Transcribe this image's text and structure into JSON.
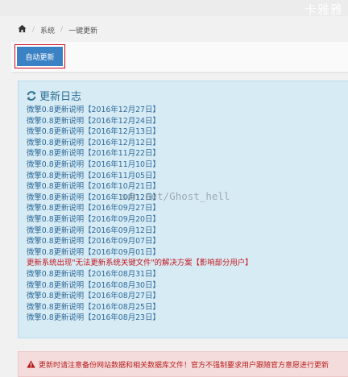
{
  "brand": "卡雅雅",
  "breadcrumb": {
    "items": [
      "系统",
      "一键更新"
    ]
  },
  "toolbar": {
    "auto_update_label": "自动更新"
  },
  "log": {
    "title": "更新日志",
    "entries": [
      {
        "text": "微擎0.8更新说明【2016年12月27日】",
        "alert": false
      },
      {
        "text": "微擎0.8更新说明【2016年12月24日】",
        "alert": false
      },
      {
        "text": "微擎0.8更新说明【2016年12月13日】",
        "alert": false
      },
      {
        "text": "微擎0.8更新说明【2016年12月12日】",
        "alert": false
      },
      {
        "text": "微擎0.8更新说明【2016年11月22日】",
        "alert": false
      },
      {
        "text": "微擎0.8更新说明【2016年11月10日】",
        "alert": false
      },
      {
        "text": "微擎0.8更新说明【2016年11月05日】",
        "alert": false
      },
      {
        "text": "微擎0.8更新说明【2016年10月21日】",
        "alert": false
      },
      {
        "text": "微擎0.8更新说明【2016年10月12日】",
        "alert": false
      },
      {
        "text": "微擎0.8更新说明【2016年09月27日】",
        "alert": false
      },
      {
        "text": "微擎0.8更新说明【2016年09月20日】",
        "alert": false
      },
      {
        "text": "微擎0.8更新说明【2016年09月12日】",
        "alert": false
      },
      {
        "text": "微擎0.8更新说明【2016年09月07日】",
        "alert": false
      },
      {
        "text": "微擎0.8更新说明【2016年09月01日】",
        "alert": false
      },
      {
        "text": "更新系统出现\"无法更新系统关键文件\"的解决方案【影响部分用户】",
        "alert": true
      },
      {
        "text": "微擎0.8更新说明【2016年08月31日】",
        "alert": false
      },
      {
        "text": "微擎0.8更新说明【2016年08月30日】",
        "alert": false
      },
      {
        "text": "微擎0.8更新说明【2016年08月27日】",
        "alert": false
      },
      {
        "text": "微擎0.8更新说明【2016年08月25日】",
        "alert": false
      },
      {
        "text": "微擎0.8更新说明【2016年08月23日】",
        "alert": false
      }
    ]
  },
  "watermark": "sdn.net/Ghost_hell",
  "warning": {
    "text": "更新时请注意备份网站数据和相关数据库文件！官方不强制要求用户跟随官方意愿进行更新"
  },
  "colors": {
    "accent": "#3b82c4",
    "link": "#2d6a98",
    "alert": "#c4161c",
    "panel_bg": "#d7ebf5",
    "warning_bg": "#f4dcdc"
  }
}
